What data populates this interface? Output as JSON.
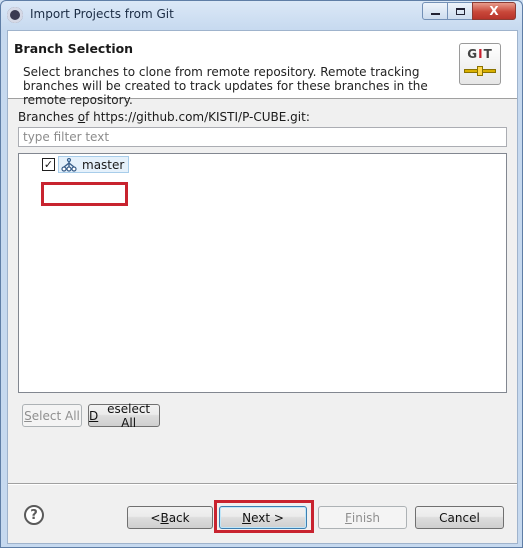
{
  "window": {
    "title": "Import Projects from Git",
    "minimize_label": "minimize",
    "maximize_label": "maximize",
    "close_label": "X"
  },
  "banner": {
    "title": "Branch Selection",
    "description": "Select branches to clone from remote repository. Remote tracking branches will be created to track updates for these branches in the remote repository.",
    "logo_icon": "git-logo-icon",
    "logo_text_prefix": "G",
    "logo_text_i": "I",
    "logo_text_suffix": "T"
  },
  "branches": {
    "label_prefix": "Branches ",
    "label_mnemonic": "o",
    "label_suffix": "f https://github.com/KISTI/P-CUBE.git:",
    "filter_placeholder": "type filter text",
    "filter_value": "",
    "items": [
      {
        "label": "master",
        "checked": true,
        "icon": "branch-icon"
      }
    ]
  },
  "buttons": {
    "select_all_mnemonic": "S",
    "select_all_rest": "elect All",
    "deselect_all_mnemonic": "D",
    "deselect_all_rest": "eselect All",
    "back_prefix": "< ",
    "back_mnemonic": "B",
    "back_rest": "ack",
    "next_mnemonic": "N",
    "next_rest": "ext >",
    "finish_mnemonic": "F",
    "finish_rest": "inish",
    "cancel": "Cancel",
    "help_glyph": "?"
  },
  "colors": {
    "highlight": "#c8232f",
    "selection_bg": "#e5f1fb"
  }
}
